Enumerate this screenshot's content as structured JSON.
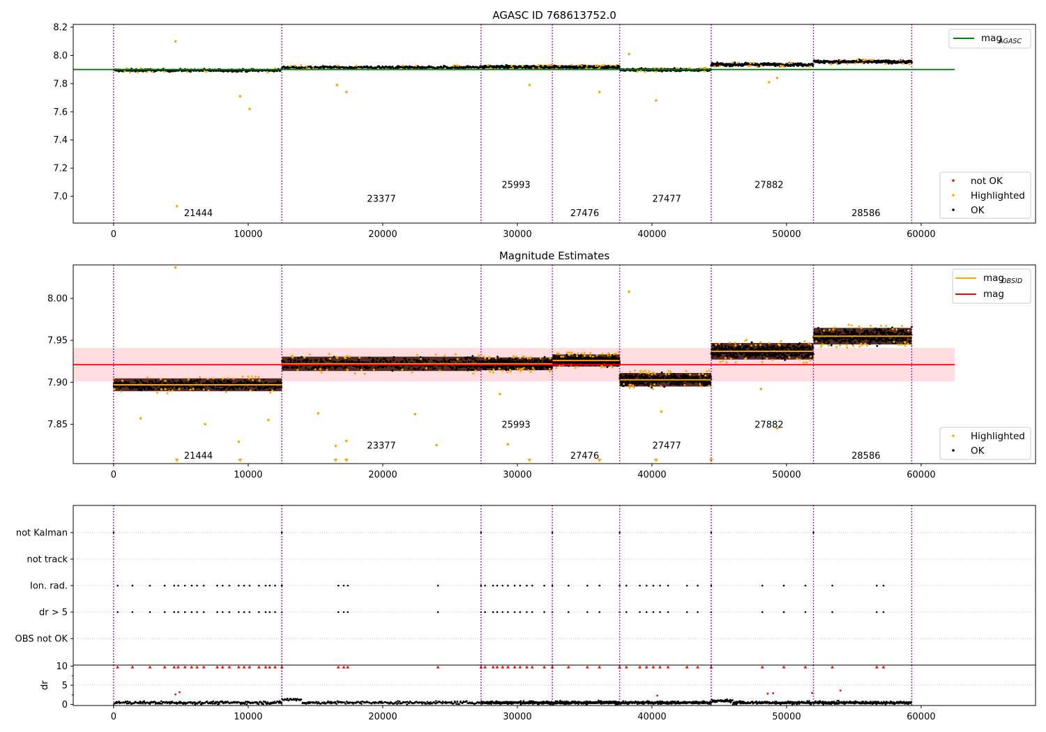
{
  "chart_data": [
    {
      "type": "scatter",
      "title": "AGASC ID 768613752.0",
      "xlim": [
        -3000,
        68500
      ],
      "ylim": [
        6.81,
        8.22
      ],
      "xticks": [
        0,
        10000,
        20000,
        30000,
        40000,
        50000,
        60000
      ],
      "yticks": [
        7.0,
        7.2,
        7.4,
        7.6,
        7.8,
        8.0,
        8.2
      ],
      "ytick_labels": [
        "7.0",
        "7.2",
        "7.4",
        "7.6",
        "7.8",
        "8.0",
        "8.2"
      ],
      "mag_agasc": 7.9,
      "mag_agasc_xrange": [
        -3000,
        62500
      ],
      "legend_top": {
        "label": "mag",
        "sub": "AGASC",
        "color": "#008000",
        "position": "top-right"
      },
      "legend_bottom": {
        "position": "lower-right",
        "entries": [
          {
            "label": "not OK",
            "color": "#ff0000"
          },
          {
            "label": "Highlighted",
            "color": "#ffa500"
          },
          {
            "label": "OK",
            "color": "#000000"
          }
        ]
      },
      "segment_levels": [
        7.894,
        7.915,
        7.918,
        7.918,
        7.898,
        7.935,
        7.955
      ],
      "segment_spreads": [
        0.012,
        0.012,
        0.012,
        0.012,
        0.012,
        0.014,
        0.014
      ],
      "highlighted_points": [
        [
          4600,
          8.1
        ],
        [
          4700,
          6.93
        ],
        [
          9400,
          7.71
        ],
        [
          10100,
          7.62
        ],
        [
          16600,
          7.79
        ],
        [
          17300,
          7.74
        ],
        [
          30900,
          7.79
        ],
        [
          36100,
          7.74
        ],
        [
          38300,
          8.01
        ],
        [
          40300,
          7.68
        ],
        [
          48700,
          7.81
        ],
        [
          49300,
          7.84
        ]
      ],
      "obsid_labels": [
        {
          "text": "21444",
          "x": 6300,
          "y": 6.88
        },
        {
          "text": "23377",
          "x": 19900,
          "y": 6.98
        },
        {
          "text": "25993",
          "x": 29900,
          "y": 7.08
        },
        {
          "text": "27476",
          "x": 35000,
          "y": 6.88
        },
        {
          "text": "27477",
          "x": 41100,
          "y": 6.98
        },
        {
          "text": "27882",
          "x": 48700,
          "y": 7.08
        },
        {
          "text": "28586",
          "x": 55900,
          "y": 6.88
        }
      ]
    },
    {
      "type": "scatter",
      "title": "Magnitude Estimates",
      "xlim": [
        -3000,
        68500
      ],
      "ylim": [
        7.803,
        8.04
      ],
      "xticks": [
        0,
        10000,
        20000,
        30000,
        40000,
        50000,
        60000
      ],
      "yticks": [
        7.85,
        7.9,
        7.95,
        8.0
      ],
      "ytick_labels": [
        "7.85",
        "7.90",
        "7.95",
        "8.00"
      ],
      "mag": 7.921,
      "mag_band": [
        7.901,
        7.941
      ],
      "mag_xrange": [
        -3000,
        62500
      ],
      "mag_obsid": [
        7.897,
        7.922,
        7.922,
        7.926,
        7.903,
        7.937,
        7.955
      ],
      "segment_spreads": [
        0.0085,
        0.0095,
        0.0085,
        0.008,
        0.009,
        0.011,
        0.011
      ],
      "legend_top": {
        "position": "top-right",
        "entries": [
          {
            "label": "mag",
            "sub": "OBSID",
            "color": "#ffa500"
          },
          {
            "label": "mag",
            "sub": "",
            "color": "#ff0000"
          }
        ]
      },
      "legend_bottom": {
        "position": "lower-right",
        "entries": [
          {
            "label": "Highlighted",
            "color": "#ffa500"
          },
          {
            "label": "OK",
            "color": "#000000"
          }
        ]
      },
      "highlighted_points": [
        [
          4600,
          8.037
        ],
        [
          2000,
          7.857
        ],
        [
          6800,
          7.85
        ],
        [
          9300,
          7.829
        ],
        [
          11500,
          7.855
        ],
        [
          15200,
          7.863
        ],
        [
          16500,
          7.824
        ],
        [
          17300,
          7.83
        ],
        [
          22400,
          7.862
        ],
        [
          24000,
          7.825
        ],
        [
          28700,
          7.886
        ],
        [
          29300,
          7.826
        ],
        [
          38300,
          8.008
        ],
        [
          40700,
          7.865
        ],
        [
          48100,
          7.892
        ],
        [
          49300,
          7.845
        ]
      ],
      "obsid_labels": [
        {
          "text": "21444",
          "x": 6300,
          "y": 7.812
        },
        {
          "text": "23377",
          "x": 19900,
          "y": 7.824
        },
        {
          "text": "25993",
          "x": 29900,
          "y": 7.849
        },
        {
          "text": "27476",
          "x": 35000,
          "y": 7.812
        },
        {
          "text": "27477",
          "x": 41100,
          "y": 7.824
        },
        {
          "text": "27882",
          "x": 48700,
          "y": 7.849
        },
        {
          "text": "28586",
          "x": 55900,
          "y": 7.812
        }
      ]
    },
    {
      "type": "scatter",
      "title": "",
      "xlim": [
        -3000,
        68500
      ],
      "categories": [
        "not Kalman",
        "not track",
        "Ion. rad.",
        "dr > 5",
        "OBS not OK"
      ],
      "flags": {
        "not Kalman": [
          0,
          12500,
          27300,
          32600,
          37600,
          44400,
          52000
        ],
        "not track": [],
        "Ion. rad.": [
          300,
          1400,
          2700,
          3800,
          4500,
          4800,
          5300,
          5800,
          6200,
          6700,
          7700,
          8100,
          8600,
          9300,
          9700,
          10100,
          10800,
          11300,
          11600,
          12000,
          12500,
          16700,
          17100,
          17400,
          24100,
          27300,
          27600,
          28200,
          28500,
          28900,
          29300,
          29800,
          30200,
          30700,
          31100,
          32000,
          32600,
          33800,
          35200,
          36100,
          37600,
          38100,
          39100,
          39600,
          40100,
          40600,
          41200,
          42600,
          43400,
          44400,
          48200,
          49800,
          51400,
          53400,
          56700,
          57200
        ],
        "dr > 5": [
          300,
          1400,
          2700,
          3800,
          4500,
          4800,
          5300,
          5800,
          6200,
          6700,
          7700,
          8100,
          8600,
          9300,
          9700,
          10100,
          10800,
          11300,
          11600,
          12000,
          12500,
          16700,
          17100,
          17400,
          24100,
          27300,
          27600,
          28200,
          28500,
          28900,
          29300,
          29800,
          30200,
          30700,
          31100,
          32000,
          32600,
          33800,
          35200,
          36100,
          37600,
          38100,
          39100,
          39600,
          40100,
          40600,
          41200,
          42600,
          43400,
          44400,
          48200,
          49800,
          51400,
          53400,
          56700,
          57200
        ],
        "OBS not OK": []
      }
    },
    {
      "type": "scatter",
      "title": "",
      "ylabel": "dr",
      "xlim": [
        -3000,
        68500
      ],
      "ylim": [
        -0.3,
        10.3
      ],
      "xticks": [
        0,
        10000,
        20000,
        30000,
        40000,
        50000,
        60000
      ],
      "yticks": [
        0,
        5,
        10
      ],
      "ytick_labels": [
        "0",
        "5",
        "10"
      ],
      "dr_max": 10,
      "outlier_points": [
        [
          4600,
          2.6
        ],
        [
          4900,
          3.2
        ],
        [
          40400,
          2.3
        ],
        [
          48600,
          2.8
        ],
        [
          49000,
          2.9
        ],
        [
          54000,
          3.6
        ],
        [
          51900,
          3.0
        ]
      ]
    }
  ],
  "obsid_boundaries": [
    0,
    12500,
    27300,
    32600,
    37600,
    44400,
    52000,
    59300
  ],
  "colors": {
    "ok": "#000000",
    "highlighted": "#ffa500",
    "not_ok": "#ff0000",
    "agasc_line": "#008000",
    "mag_line": "#ff0000",
    "mag_band": "#ffdde0",
    "obsid_line": "#ffa500",
    "boundary": "#800080",
    "grid": "#b0b0b0"
  }
}
